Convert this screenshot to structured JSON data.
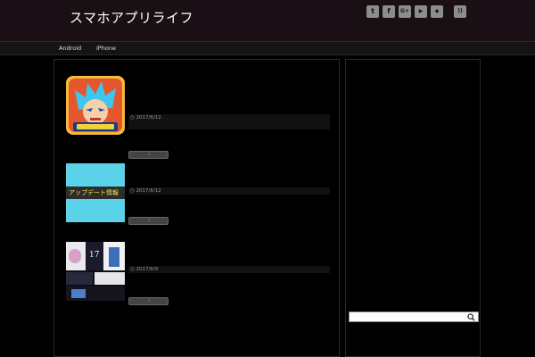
{
  "header": {
    "site_title": "スマホアプリライフ",
    "tagline": ""
  },
  "social": [
    {
      "icon": "twitter-icon",
      "glyph": "t"
    },
    {
      "icon": "facebook-icon",
      "glyph": "f"
    },
    {
      "icon": "google-plus-icon",
      "glyph": "G+"
    },
    {
      "icon": "youtube-icon",
      "glyph": "▶"
    },
    {
      "icon": "feedly-icon",
      "glyph": "◆"
    },
    {
      "icon": "rss-icon",
      "glyph": "))"
    }
  ],
  "nav": {
    "items": [
      "Android",
      "iPhone",
      "",
      "",
      "",
      "",
      "",
      ""
    ]
  },
  "posts": [
    {
      "title": "",
      "date": "2017/6/12",
      "meta_rest": "",
      "excerpt": "",
      "more": "",
      "thumb": "dokkan-battle"
    },
    {
      "title": "",
      "date": "2017/6/12",
      "meta_rest": "",
      "excerpt": "",
      "more": "",
      "thumb": "update-info",
      "thumb_text": "アップデート情報"
    },
    {
      "title": "",
      "date": "2017/6/9",
      "meta_rest": "",
      "excerpt": "",
      "more": "",
      "thumb": "game-collage",
      "thumb_text": "17"
    }
  ],
  "sidebar": {
    "search_placeholder": "",
    "widget_title": ""
  },
  "colors": {
    "header_bg": "#1a0f14",
    "link_blue": "#7aa6d8",
    "thumb_cyan": "#5ad3e8"
  }
}
